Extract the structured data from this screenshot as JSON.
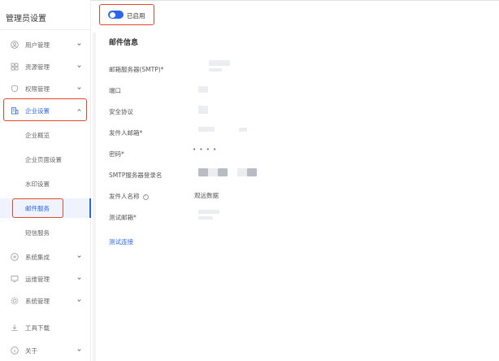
{
  "sidebar": {
    "title": "管理员设置",
    "menu": [
      {
        "label": "用户管理",
        "icon": "user-circle-icon",
        "open": false
      },
      {
        "label": "资源管理",
        "icon": "grid-icon",
        "open": false
      },
      {
        "label": "权限管理",
        "icon": "shield-icon",
        "open": false
      },
      {
        "label": "企业设置",
        "icon": "building-icon",
        "open": true
      }
    ],
    "submenu": [
      {
        "label": "企业概览"
      },
      {
        "label": "企业页面设置"
      },
      {
        "label": "水印设置"
      },
      {
        "label": "邮件服务",
        "active": true
      },
      {
        "label": "短信服务"
      }
    ],
    "menu_after": [
      {
        "label": "系统集成",
        "icon": "integration-icon"
      },
      {
        "label": "运维管理",
        "icon": "monitor-icon"
      },
      {
        "label": "系统管理",
        "icon": "settings-icon"
      },
      {
        "label": "工具下载",
        "icon": "download-icon"
      },
      {
        "label": "关于",
        "icon": "info-icon"
      }
    ]
  },
  "toggle": {
    "label": "已启用",
    "enabled": true
  },
  "form": {
    "section_title": "邮件信息",
    "fields": [
      {
        "label": "邮箱服务器(SMTP)*"
      },
      {
        "label": "端口"
      },
      {
        "label": "安全协议"
      },
      {
        "label": "发件人邮箱*"
      },
      {
        "label": "密码*",
        "value": "• •         • •"
      },
      {
        "label": "SMTP服务器登录名"
      },
      {
        "label": "发件人名称",
        "value": "观远数据"
      },
      {
        "label": "测试邮箱*"
      }
    ],
    "test_link": "测试连接"
  },
  "colors": {
    "accent": "#2b67e8",
    "highlight": "#e5492d"
  }
}
